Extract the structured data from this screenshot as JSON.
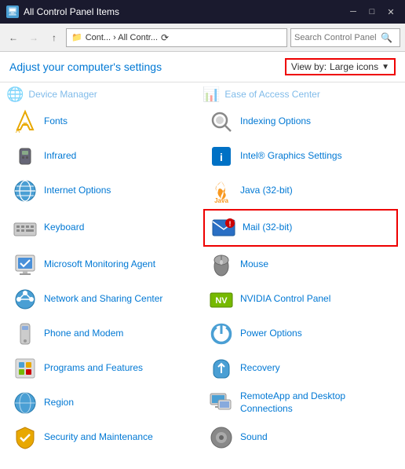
{
  "titlebar": {
    "icon": "🖥",
    "title": "All Control Panel Items",
    "minimize": "─",
    "maximize": "□",
    "close": "✕"
  },
  "addressbar": {
    "back": "←",
    "forward": "→",
    "up": "↑",
    "path": " Cont... › All Contr...",
    "refresh": "⟳",
    "search_placeholder": "Search Control Panel"
  },
  "header": {
    "title": "Adjust your computer's settings",
    "view_by_label": "View by:",
    "view_by_value": "Large icons",
    "dropdown_arrow": "▼"
  },
  "items": [
    {
      "id": "fonts",
      "icon": "🅰",
      "label": "Fonts",
      "highlighted": false,
      "icon_color": "#e8a800",
      "icon_type": "fonts"
    },
    {
      "id": "indexing-options",
      "icon": "🔍",
      "label": "Indexing Options",
      "highlighted": false,
      "icon_type": "indexing"
    },
    {
      "id": "infrared",
      "icon": "📡",
      "label": "Infrared",
      "highlighted": false,
      "icon_type": "infrared"
    },
    {
      "id": "intel-graphics",
      "icon": "💻",
      "label": "Intel® Graphics Settings",
      "highlighted": false,
      "icon_type": "intel"
    },
    {
      "id": "internet-options",
      "icon": "🌐",
      "label": "Internet Options",
      "highlighted": false,
      "icon_type": "internet"
    },
    {
      "id": "java",
      "icon": "☕",
      "label": "Java (32-bit)",
      "highlighted": false,
      "icon_type": "java"
    },
    {
      "id": "keyboard",
      "icon": "⌨",
      "label": "Keyboard",
      "highlighted": false,
      "icon_type": "keyboard"
    },
    {
      "id": "mail",
      "icon": "📧",
      "label": "Mail (32-bit)",
      "highlighted": true,
      "icon_type": "mail"
    },
    {
      "id": "microsoft-monitoring",
      "icon": "🖥",
      "label": "Microsoft Monitoring Agent",
      "highlighted": false,
      "icon_type": "mma"
    },
    {
      "id": "mouse",
      "icon": "🖱",
      "label": "Mouse",
      "highlighted": false,
      "icon_type": "mouse"
    },
    {
      "id": "network-sharing",
      "icon": "🌐",
      "label": "Network and Sharing Center",
      "highlighted": false,
      "icon_type": "network"
    },
    {
      "id": "nvidia",
      "icon": "🎮",
      "label": "NVIDIA Control Panel",
      "highlighted": false,
      "icon_type": "nvidia"
    },
    {
      "id": "phone-modem",
      "icon": "📞",
      "label": "Phone and Modem",
      "highlighted": false,
      "icon_type": "phone"
    },
    {
      "id": "power-options",
      "icon": "⚡",
      "label": "Power Options",
      "highlighted": false,
      "icon_type": "power"
    },
    {
      "id": "programs-features",
      "icon": "📦",
      "label": "Programs and Features",
      "highlighted": false,
      "icon_type": "programs"
    },
    {
      "id": "recovery",
      "icon": "🔧",
      "label": "Recovery",
      "highlighted": false,
      "icon_type": "recovery"
    },
    {
      "id": "region",
      "icon": "🌍",
      "label": "Region",
      "highlighted": false,
      "icon_type": "region"
    },
    {
      "id": "remoteapp",
      "icon": "🖥",
      "label": "RemoteApp and Desktop Connections",
      "highlighted": false,
      "icon_type": "remote"
    },
    {
      "id": "security-maintenance",
      "icon": "🛡",
      "label": "Security and Maintenance",
      "highlighted": false,
      "icon_type": "security"
    },
    {
      "id": "sound",
      "icon": "🔊",
      "label": "Sound",
      "highlighted": false,
      "icon_type": "sound"
    }
  ]
}
